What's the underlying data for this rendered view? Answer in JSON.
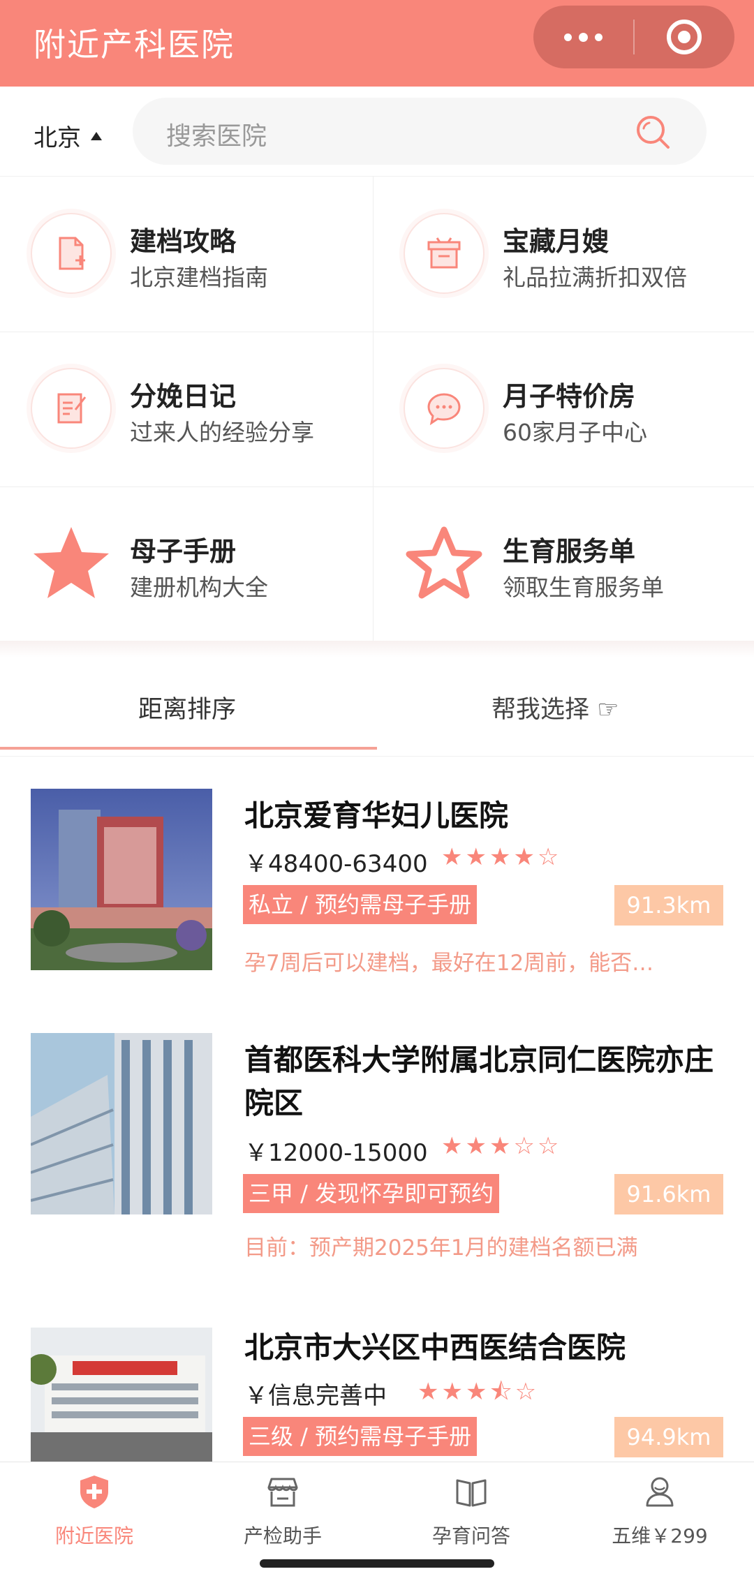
{
  "header": {
    "title": "附近产科医院"
  },
  "search": {
    "city": "北京",
    "placeholder": "搜索医院"
  },
  "grid": [
    {
      "name": "建档攻略",
      "desc": "北京建档指南",
      "icon": "document-add-icon"
    },
    {
      "name": "宝藏月嫂",
      "desc": "礼品拉满折扣双倍",
      "icon": "gift-box-icon"
    },
    {
      "name": "分娩日记",
      "desc": "过来人的经验分享",
      "icon": "edit-note-icon"
    },
    {
      "name": "月子特价房",
      "desc": "60家月子中心",
      "icon": "chat-bubble-icon"
    },
    {
      "name": "母子手册",
      "desc": "建册机构大全",
      "icon": "star-filled-icon"
    },
    {
      "name": "生育服务单",
      "desc": "领取生育服务单",
      "icon": "star-outline-icon"
    }
  ],
  "tabs": {
    "distance": "距离排序",
    "help": "帮我选择 ☞"
  },
  "hospitals": [
    {
      "name": "北京爱育华妇儿医院",
      "price": "￥48400-63400",
      "stars": "★★★★☆",
      "tag": "私立 / 预约需母子手册",
      "distance": "91.3km",
      "note": "孕7周后可以建档，最好在12周前，能否…"
    },
    {
      "name": "首都医科大学附属北京同仁医院亦庄院区",
      "price": "￥12000-15000",
      "stars": "★★★☆☆",
      "tag": "三甲 / 发现怀孕即可预约",
      "distance": "91.6km",
      "note": "目前：预产期2025年1月的建档名额已满"
    },
    {
      "name": "北京市大兴区中西医结合医院",
      "price": "￥信息完善中",
      "stars": "★★★⯪☆",
      "tag": "三级 / 预约需母子手册",
      "distance": "94.9km",
      "note": ""
    }
  ],
  "bottom_nav": [
    {
      "label": "附近医院",
      "icon": "hospital-shield-icon",
      "active": true
    },
    {
      "label": "产检助手",
      "icon": "store-icon",
      "active": false
    },
    {
      "label": "孕育问答",
      "icon": "book-icon",
      "active": false
    },
    {
      "label": "五维￥299",
      "icon": "user-icon",
      "active": false
    }
  ],
  "colors": {
    "primary": "#f9867a",
    "distance_badge": "#fdc8a6",
    "note": "#f39a88"
  }
}
